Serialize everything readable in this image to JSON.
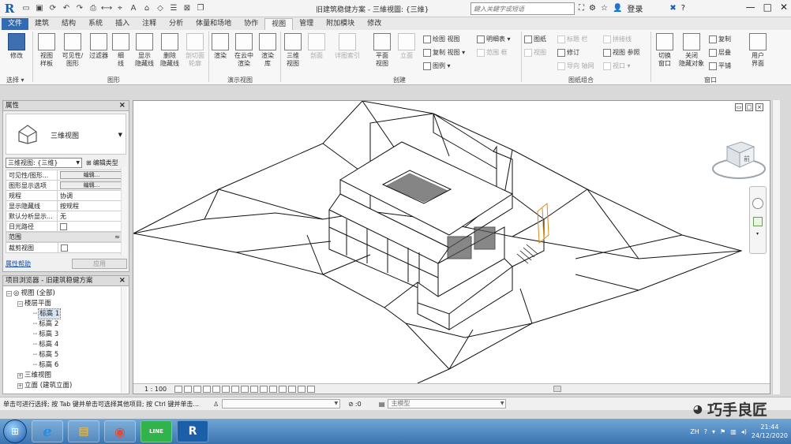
{
  "app": {
    "logo": "R",
    "window_title": "旧建筑稳健方案 - 三維視圖: {三維}",
    "search_placeholder": "鍵入关鍵字或短语",
    "login_label": "登录",
    "minimize": "—",
    "maximize": "□",
    "close": "✕"
  },
  "ribbon_tabs": [
    {
      "label": "文件"
    },
    {
      "label": "建筑"
    },
    {
      "label": "結构"
    },
    {
      "label": "系统"
    },
    {
      "label": "插入"
    },
    {
      "label": "注释"
    },
    {
      "label": "分析"
    },
    {
      "label": "体量和场地"
    },
    {
      "label": "协作"
    },
    {
      "label": "视图"
    },
    {
      "label": "管理"
    },
    {
      "label": "附加模块"
    },
    {
      "label": "修改"
    }
  ],
  "ribbon": {
    "modify": "修改",
    "select": "选择 ▾",
    "view_template": "视图\n样板",
    "visibility_graphics": "可见性/\n图形",
    "filters": "过滤器",
    "thin_lines": "细\n线",
    "show_hidden_lines": "显示\n隐藏线",
    "remove_hidden_lines": "删除\n隐藏线",
    "cut_profile": "剖切面\n轮廓",
    "group_graphics": "图形",
    "render": "渲染",
    "render_cloud": "在云中\n渲染",
    "render_gallery": "渲染\n库",
    "group_presentation": "演示视图",
    "view_3d": "三维\n视图",
    "section": "剖面",
    "callout": "详图索引",
    "plan_views": "平面\n视图",
    "elevation": "立面",
    "drafting_view": "绘图 视图",
    "duplicate_view": "复制 视图 ▾",
    "legends": "图例 ▾",
    "schedules": "明细表 ▾",
    "scope_box": "范围 框",
    "group_create": "创建",
    "sheet": "图纸",
    "view_place": "视图",
    "title_block": "标题 栏",
    "revisions": "修订",
    "guide_grid": "导向 轴网",
    "matchline": "拼接线",
    "view_reference": "视图 参照",
    "viewports": "视口 ▾",
    "group_sheet": "图纸组合",
    "switch_windows": "切换\n窗口",
    "close_hidden": "关闭\n隐藏对象",
    "replicate": "复制",
    "cascade": "层叠",
    "tile": "平铺",
    "user_interface": "用户\n界面",
    "group_windows": "窗口"
  },
  "properties": {
    "title": "属性",
    "type_name": "三维视图",
    "selector": "三维视图: {三维}",
    "edit_type": "编辑类型",
    "rows": [
      {
        "key": "可见性/图形...",
        "value": "编辑...",
        "kind": "button"
      },
      {
        "key": "图形显示选项",
        "value": "编辑...",
        "kind": "button"
      },
      {
        "key": "规程",
        "value": "协调",
        "kind": "text"
      },
      {
        "key": "显示隐藏线",
        "value": "按规程",
        "kind": "text"
      },
      {
        "key": "默认分析显示...",
        "value": "无",
        "kind": "text"
      },
      {
        "key": "日光路径",
        "value": "",
        "kind": "check"
      }
    ],
    "section_extents": "范围",
    "crop_view": "裁剪视图",
    "help_link": "属性帮助",
    "apply": "应用"
  },
  "browser": {
    "title": "项目浏览器 - 旧建筑稳健方案",
    "items": [
      {
        "label": "视图 (全部)",
        "level": 0,
        "toggle": "−"
      },
      {
        "label": "楼层平面",
        "level": 1,
        "toggle": "−"
      },
      {
        "label": "标高 1",
        "level": 2,
        "toggle": "",
        "selected": true
      },
      {
        "label": "标高 2",
        "level": 2,
        "toggle": ""
      },
      {
        "label": "标高 3",
        "level": 2,
        "toggle": ""
      },
      {
        "label": "标高 4",
        "level": 2,
        "toggle": ""
      },
      {
        "label": "标高 5",
        "level": 2,
        "toggle": ""
      },
      {
        "label": "标高 6",
        "level": 2,
        "toggle": ""
      },
      {
        "label": "三维视图",
        "level": 1,
        "toggle": "+"
      },
      {
        "label": "立面 (建筑立面)",
        "level": 1,
        "toggle": "+"
      }
    ]
  },
  "viewport": {
    "scale": "1 : 100",
    "viewcube_face": "前"
  },
  "status": {
    "message": "单击可进行选择; 按 Tab 键并单击可选择其他项目; 按 Ctrl 键并单击...",
    "workset_value": ":0",
    "model_label": "主模型",
    "watermark": "巧手良匠"
  },
  "taskbar": {
    "apps": [
      {
        "name": "ie",
        "glyph": "e"
      },
      {
        "name": "explorer",
        "glyph": "▤"
      },
      {
        "name": "chrome",
        "glyph": "◉"
      },
      {
        "name": "line",
        "glyph": "LINE"
      },
      {
        "name": "revit",
        "glyph": "R"
      }
    ],
    "ime": "ZH",
    "time": "21:44",
    "date": "24/12/2020"
  },
  "colors": {
    "ribbon_file_tab": "#2f6cb5",
    "selection": "#d7e4f3",
    "taskbar": "#3a74b0"
  }
}
